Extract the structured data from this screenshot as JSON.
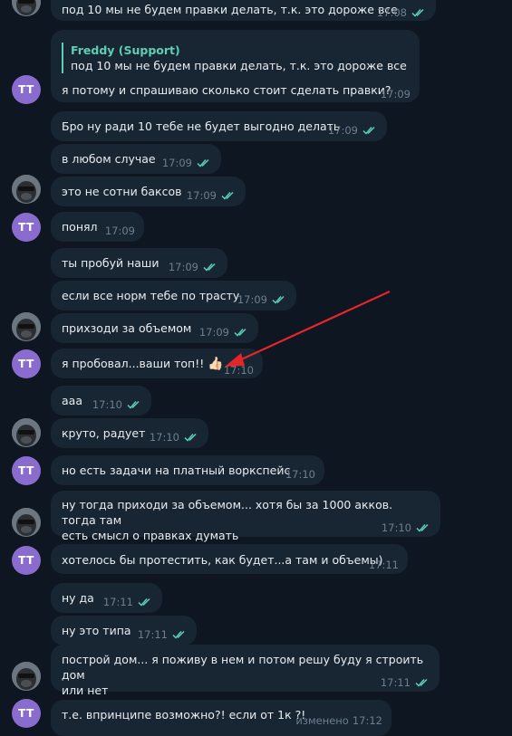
{
  "chat": {
    "messages": [
      {
        "text": "под 10 мы не будем правки делать, т.к. это дороже все",
        "time": "17:08",
        "side": "support",
        "read": true
      },
      {
        "reply_name": "Freddy (Support)",
        "reply_text": "под 10 мы не будем правки делать, т.к. это дороже все",
        "text": "я потому и спрашиваю сколько стоит сделать правки?",
        "time": "17:09",
        "side": "user"
      },
      {
        "text": "Бро ну ради 10 тебе не будет выгодно делать",
        "time": "17:09",
        "side": "support",
        "read": true
      },
      {
        "text": "в любом случае",
        "time": "17:09",
        "side": "support",
        "read": true
      },
      {
        "text": "это не сотни баксов",
        "time": "17:09",
        "side": "support",
        "read": true
      },
      {
        "text": "понял",
        "time": "17:09",
        "side": "user"
      },
      {
        "text": "ты пробуй наши",
        "time": "17:09",
        "side": "support",
        "read": true
      },
      {
        "text": "если все норм тебе по трасту",
        "time": "17:09",
        "side": "support",
        "read": true
      },
      {
        "text": "прихзоди за объемом",
        "time": "17:09",
        "side": "support",
        "read": true
      },
      {
        "text": "я пробовал...ваши топ!!",
        "emoji": "👍🏻",
        "time": "17:10",
        "side": "user"
      },
      {
        "text": "ааа",
        "time": "17:10",
        "side": "support",
        "read": true
      },
      {
        "text": "круто, радует",
        "time": "17:10",
        "side": "support",
        "read": true
      },
      {
        "text": "но есть задачи на платный воркспейс",
        "time": "17:10",
        "side": "user"
      },
      {
        "text": "ну тогда приходи за объемом... хотя бы за 1000 акков. тогда там\nесть смысл о правках думать",
        "time": "17:10",
        "side": "support",
        "read": true
      },
      {
        "text": "хотелось бы протестить, как будет...а там и объемы)",
        "time": "17:11",
        "side": "user"
      },
      {
        "text": "ну да",
        "time": "17:11",
        "side": "support",
        "read": true
      },
      {
        "text": "ну это типа",
        "time": "17:11",
        "side": "support",
        "read": true
      },
      {
        "text": "построй дом... я поживу в нем и потом решу буду я строить дом\nили нет",
        "time": "17:11",
        "side": "support",
        "read": true
      },
      {
        "text": "т.е. впринципе возможно?! если от 1к ?!",
        "edited": "изменено",
        "time": "17:12",
        "side": "user"
      }
    ],
    "user_avatar_initials": "TT",
    "support_avatar_icon": "gorilla-avatar-icon",
    "check_icon": "double-check-icon"
  },
  "colors": {
    "background": "#0e1621",
    "bubble": "#182533",
    "accent": "#5ccfb6",
    "avatar_user": "#8a6ccf",
    "annotation_arrow": "#e3262a"
  }
}
